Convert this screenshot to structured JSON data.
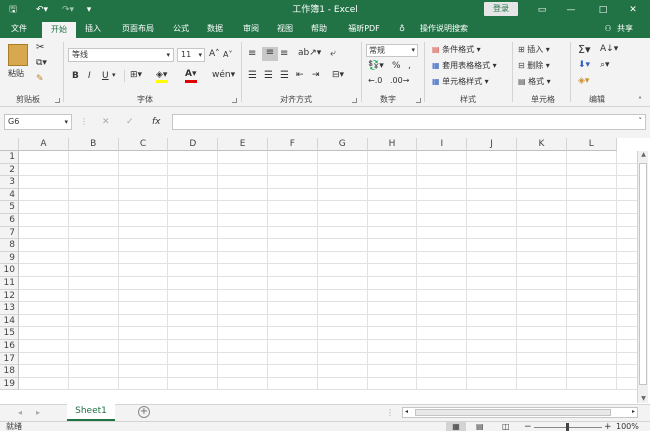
{
  "titlebar": {
    "title": "工作簿1 - Excel",
    "login": "登录"
  },
  "tabs": [
    "文件",
    "开始",
    "插入",
    "页面布局",
    "公式",
    "数据",
    "审阅",
    "视图",
    "帮助",
    "福昕PDF"
  ],
  "tell_me": "操作说明搜索",
  "share": "共享",
  "ribbon": {
    "groups": {
      "clipboard": "剪贴板",
      "font": "字体",
      "align": "对齐方式",
      "number": "数字",
      "styles": "样式",
      "cells": "单元格",
      "edit": "编辑"
    },
    "paste": "粘贴",
    "font_name": "等线",
    "font_size": "11",
    "number_format": "常规",
    "cond_format": "条件格式",
    "table_format": "套用表格格式",
    "cell_styles": "单元格样式",
    "insert": "插入",
    "delete": "删除",
    "format": "格式",
    "bold": "B",
    "italic": "I",
    "underline": "U"
  },
  "formula_bar": {
    "name_box": "G6",
    "fx": "fx",
    "content": ""
  },
  "columns": [
    "A",
    "B",
    "C",
    "D",
    "E",
    "F",
    "G",
    "H",
    "I",
    "J",
    "K",
    "L"
  ],
  "rows": [
    "1",
    "2",
    "3",
    "4",
    "5",
    "6",
    "7",
    "8",
    "9",
    "10",
    "11",
    "12",
    "13",
    "14",
    "15",
    "16",
    "17",
    "18",
    "19"
  ],
  "sheet_tab": "Sheet1",
  "status": {
    "ready": "就绪",
    "zoom": "100%"
  },
  "colors": {
    "brand": "#217346",
    "ribbon_bg": "#f3f3f3"
  }
}
